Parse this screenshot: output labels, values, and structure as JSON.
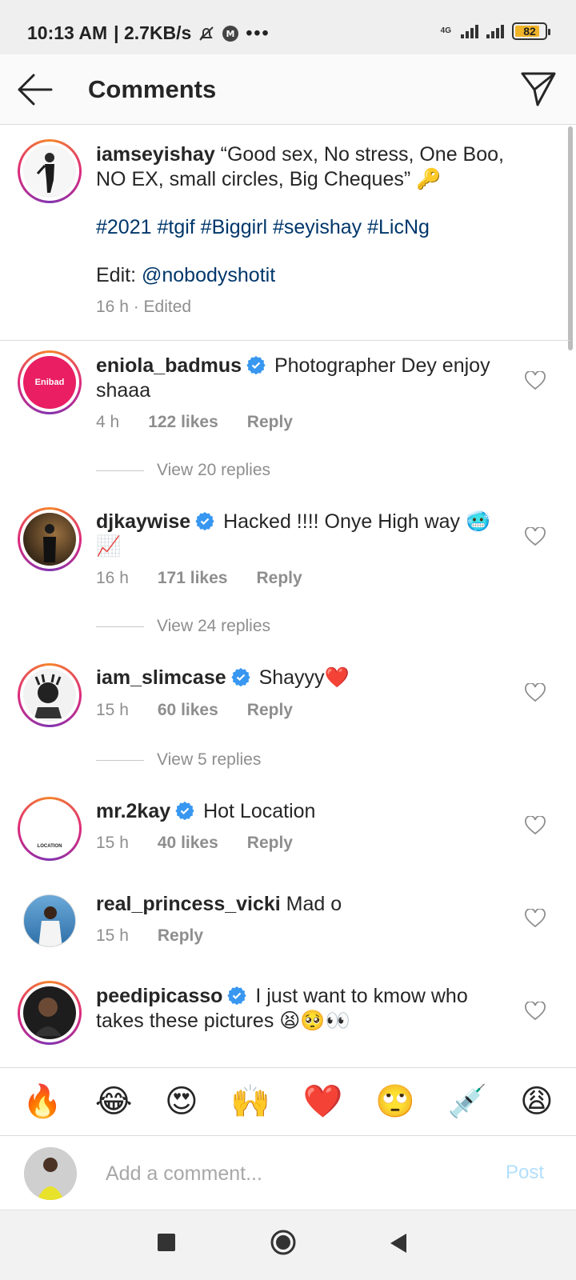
{
  "status_bar": {
    "time": "10:13 AM",
    "speed": "| 2.7KB/s",
    "network": "4G",
    "battery": "82",
    "battery_level": 0.82
  },
  "header": {
    "title": "Comments",
    "back_icon": "arrow-left-icon",
    "send_icon": "paper-plane-icon"
  },
  "caption": {
    "username": "iamseyishay",
    "text_1": " “Good sex, No stress, One Boo,",
    "text_2": "NO EX, small circles, Big Cheques” 🔑",
    "hashtags": "#2021 #tgif #Biggirl #seyishay #LicNg",
    "edit_label": "Edit: ",
    "edit_mention": "@nobodyshotit",
    "meta": "16 h · Edited"
  },
  "comments": [
    {
      "username": "eniola_badmus",
      "verified": true,
      "text_1": " Photographer Dey enjoy",
      "text_2": "shaaa",
      "time": "4 h",
      "likes": "122 likes",
      "reply": "Reply",
      "view_replies": "View 20 replies",
      "avatar_text": "Enibad"
    },
    {
      "username": "djkaywise",
      "verified": true,
      "text_1": " Hacked !!!! Onye High way 🥶",
      "text_2": "📈",
      "time": "16 h",
      "likes": "171 likes",
      "reply": "Reply",
      "view_replies": "View 24 replies"
    },
    {
      "username": "iam_slimcase",
      "verified": true,
      "text_1": " Shayyy❤️",
      "time": "15 h",
      "likes": "60 likes",
      "reply": "Reply",
      "view_replies": "View 5 replies"
    },
    {
      "username": "mr.2kay",
      "verified": true,
      "text_1": " Hot Location",
      "time": "15 h",
      "likes": "40 likes",
      "reply": "Reply",
      "avatar_text": "LOCATION"
    },
    {
      "username": "real_princess_vicki",
      "verified": false,
      "text_1": " Mad o",
      "time": "15 h",
      "reply": "Reply"
    },
    {
      "username": "peedipicasso",
      "verified": true,
      "text_1": " I just want to kmow who",
      "text_2": "takes these pictures 😫🥺👀"
    }
  ],
  "emoji_bar": [
    "🔥",
    "😂",
    "😍",
    "🙌",
    "❤️",
    "🙄",
    "💉",
    "😩"
  ],
  "compose": {
    "placeholder": "Add a comment...",
    "post_label": "Post"
  },
  "colors": {
    "link": "#00376b",
    "meta": "#8e8e8e",
    "verified": "#3897f0",
    "post_disabled": "#b2dffc"
  }
}
